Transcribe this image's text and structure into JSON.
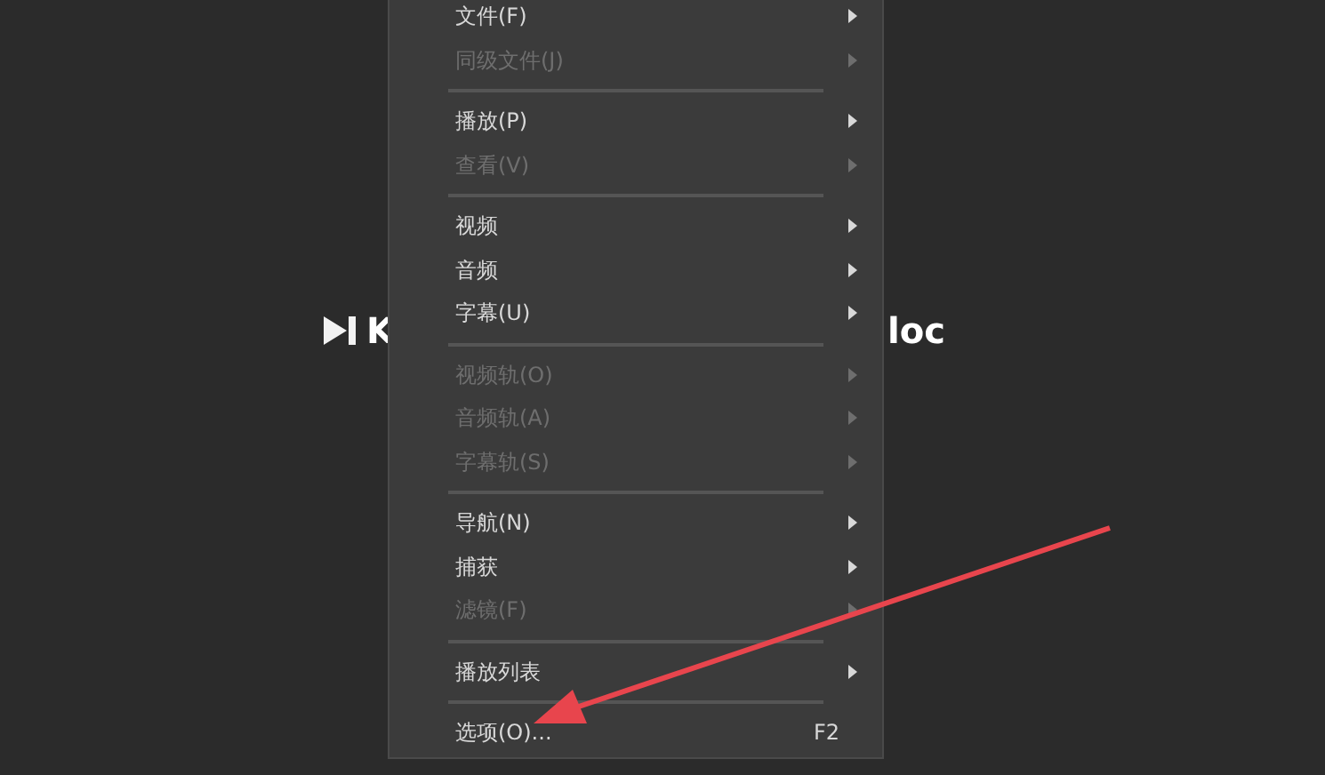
{
  "background": {
    "logo_left": "K",
    "logo_right": "loc"
  },
  "menu": [
    {
      "kind": "item",
      "label": "文件(F)",
      "disabled": false,
      "submenu": true
    },
    {
      "kind": "item",
      "label": "同级文件(J)",
      "disabled": true,
      "submenu": true
    },
    {
      "kind": "separator"
    },
    {
      "kind": "item",
      "label": "播放(P)",
      "disabled": false,
      "submenu": true
    },
    {
      "kind": "item",
      "label": "查看(V)",
      "disabled": true,
      "submenu": true
    },
    {
      "kind": "separator"
    },
    {
      "kind": "item",
      "label": "视频",
      "disabled": false,
      "submenu": true
    },
    {
      "kind": "item",
      "label": "音频",
      "disabled": false,
      "submenu": true
    },
    {
      "kind": "item",
      "label": "字幕(U)",
      "disabled": false,
      "submenu": true
    },
    {
      "kind": "separator"
    },
    {
      "kind": "item",
      "label": "视频轨(O)",
      "disabled": true,
      "submenu": true
    },
    {
      "kind": "item",
      "label": "音频轨(A)",
      "disabled": true,
      "submenu": true
    },
    {
      "kind": "item",
      "label": "字幕轨(S)",
      "disabled": true,
      "submenu": true
    },
    {
      "kind": "separator"
    },
    {
      "kind": "item",
      "label": "导航(N)",
      "disabled": false,
      "submenu": true
    },
    {
      "kind": "item",
      "label": "捕获",
      "disabled": false,
      "submenu": true
    },
    {
      "kind": "item",
      "label": "滤镜(F)",
      "disabled": true,
      "submenu": true
    },
    {
      "kind": "separator"
    },
    {
      "kind": "item",
      "label": "播放列表",
      "disabled": false,
      "submenu": true
    },
    {
      "kind": "separator"
    },
    {
      "kind": "item",
      "label": "选项(O)...",
      "disabled": false,
      "submenu": false,
      "shortcut": "F2"
    }
  ]
}
